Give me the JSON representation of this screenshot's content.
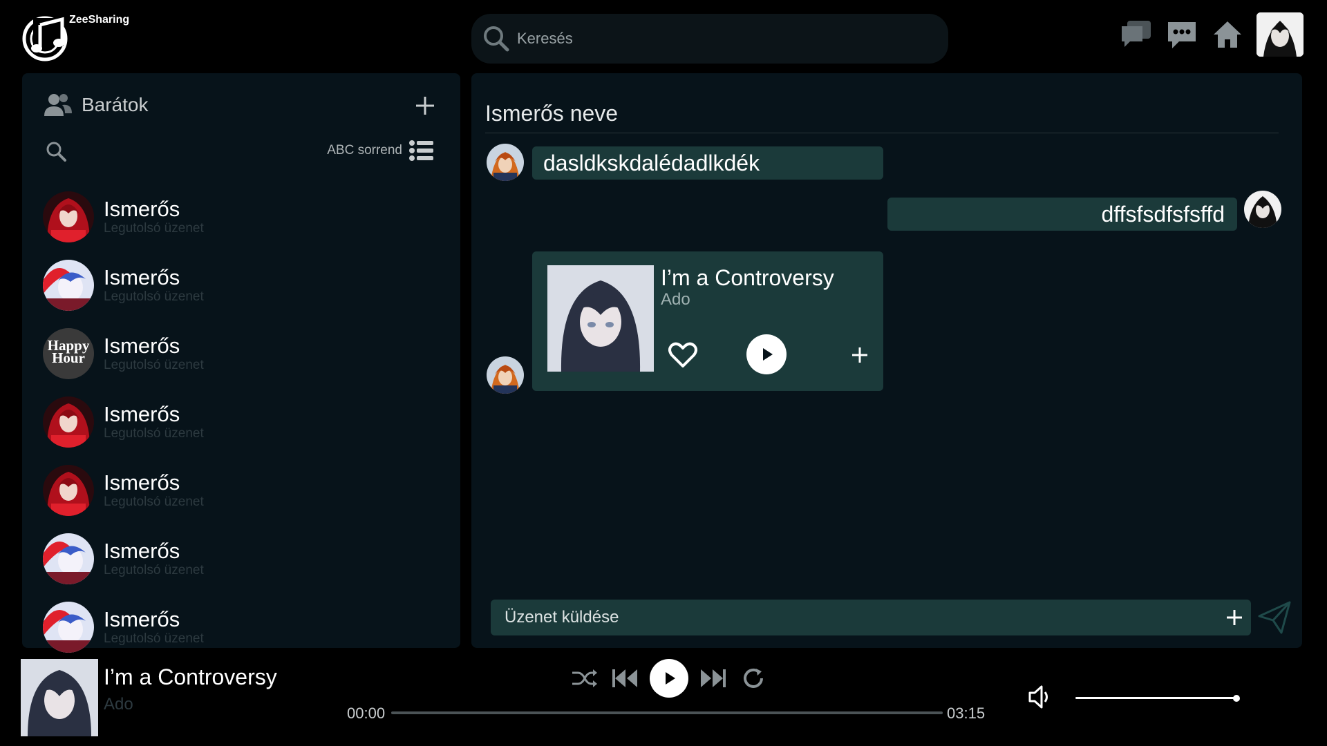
{
  "app": {
    "name": "ZeeSharing"
  },
  "search": {
    "placeholder": "Keresés"
  },
  "top_icons": [
    "chat-icon",
    "message-icon",
    "home-icon",
    "profile-avatar"
  ],
  "friends": {
    "title": "Barátok",
    "sort_label": "ABC sorrend",
    "items": [
      {
        "name": "Ismerős",
        "last_message": "Legutolsó üzenet",
        "avatar": "red"
      },
      {
        "name": "Ismerős",
        "last_message": "Legutolsó üzenet",
        "avatar": "blue"
      },
      {
        "name": "Ismerős",
        "last_message": "Legutolsó üzenet",
        "avatar": "happy",
        "avatar_text": "Happy Hour"
      },
      {
        "name": "Ismerős",
        "last_message": "Legutolsó üzenet",
        "avatar": "red"
      },
      {
        "name": "Ismerős",
        "last_message": "Legutolsó üzenet",
        "avatar": "red"
      },
      {
        "name": "Ismerős",
        "last_message": "Legutolsó üzenet",
        "avatar": "blue"
      },
      {
        "name": "Ismerős",
        "last_message": "Legutolsó üzenet",
        "avatar": "blue"
      }
    ]
  },
  "chat": {
    "title": "Ismerős neve",
    "messages": [
      {
        "from": "them",
        "text": "dasldkskdalédadlkdék"
      },
      {
        "from": "me",
        "text": "dffsfsdfsfsffd"
      }
    ],
    "shared_song": {
      "title": "I’m a Controversy",
      "artist": "Ado"
    },
    "composer_placeholder": "Üzenet küldése"
  },
  "player": {
    "title": "I’m a Controversy",
    "artist": "Ado",
    "current_time": "00:00",
    "duration": "03:15",
    "progress": 0,
    "volume": 0.98
  },
  "colors": {
    "bubble": "#1b3a3a",
    "panel": "#07131a",
    "muted_text": "#2d3a40"
  }
}
